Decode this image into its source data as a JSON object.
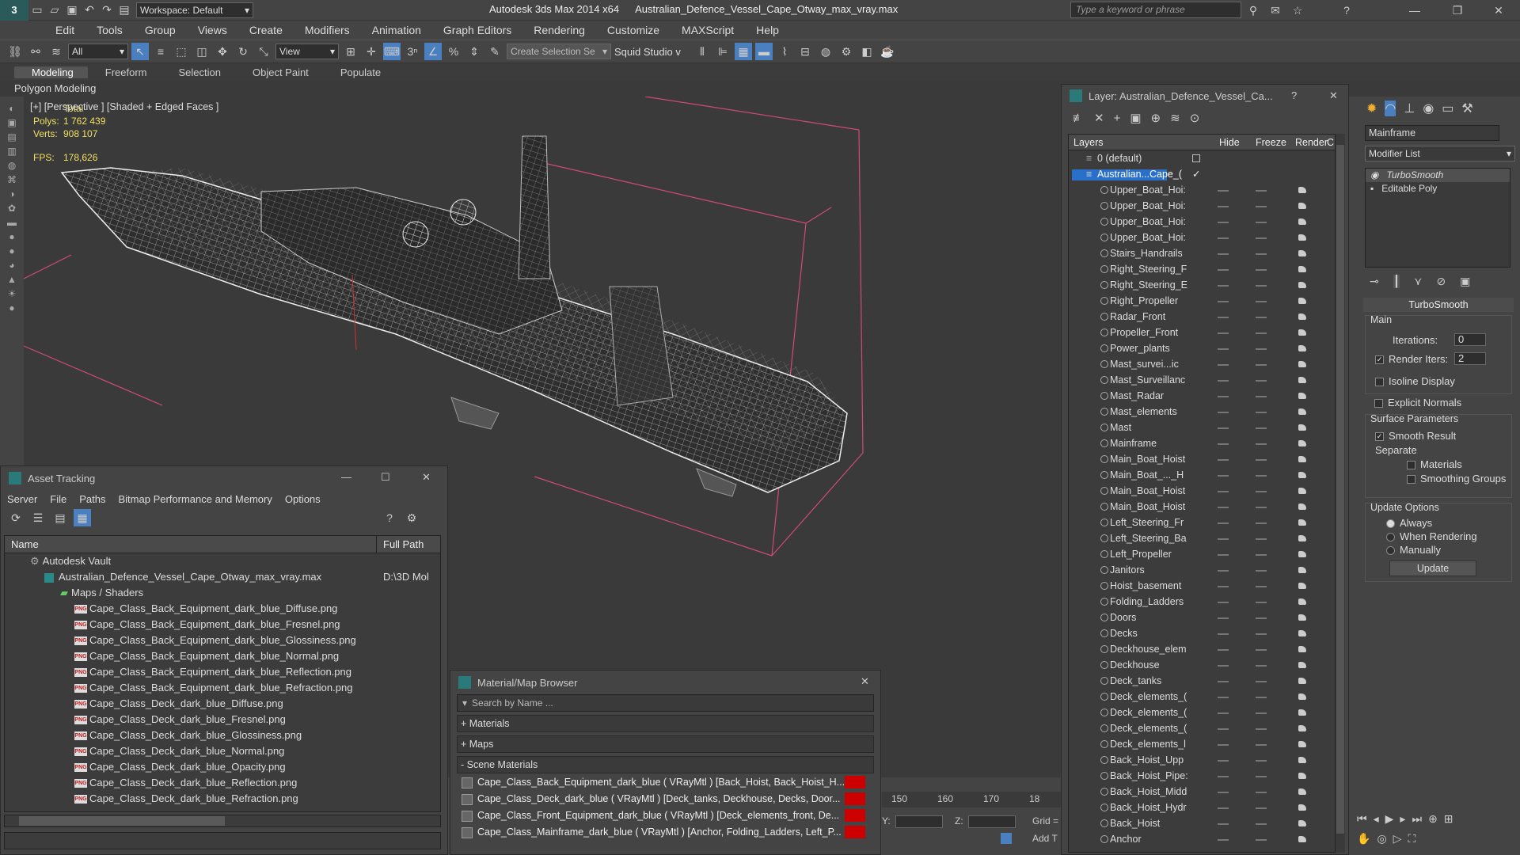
{
  "app": {
    "title": "Autodesk 3ds Max  2014 x64",
    "file": "Australian_Defence_Vessel_Cape_Otway_max_vray.max",
    "workspace": "Workspace: Default",
    "search_placeholder": "Type a keyword or phrase"
  },
  "menu": [
    "Edit",
    "Tools",
    "Group",
    "Views",
    "Create",
    "Modifiers",
    "Animation",
    "Graph Editors",
    "Rendering",
    "Customize",
    "MAXScript",
    "Help"
  ],
  "toolbar": {
    "filter": "All",
    "view": "View",
    "selection_set": "Create Selection Se",
    "squid": "Squid Studio v"
  },
  "ribbon": {
    "tabs": [
      "Modeling",
      "Freeform",
      "Selection",
      "Object Paint",
      "Populate"
    ],
    "sub": "Polygon Modeling"
  },
  "viewport": {
    "label": "[+] [Perspective ] [Shaded + Edged Faces ]",
    "stats_header": "Total",
    "polys_label": "Polys:",
    "polys": "1 762 439",
    "verts_label": "Verts:",
    "verts": "908 107",
    "fps_label": "FPS:",
    "fps": "178,626"
  },
  "asset_tracking": {
    "title": "Asset Tracking",
    "menu": [
      "Server",
      "File",
      "Paths",
      "Bitmap Performance and Memory",
      "Options"
    ],
    "col_name": "Name",
    "col_path": "Full Path",
    "vault": "Autodesk Vault",
    "file": "Australian_Defence_Vessel_Cape_Otway_max_vray.max",
    "file_path": "D:\\3D Mol",
    "maps_group": "Maps / Shaders",
    "maps": [
      "Cape_Class_Back_Equipment_dark_blue_Diffuse.png",
      "Cape_Class_Back_Equipment_dark_blue_Fresnel.png",
      "Cape_Class_Back_Equipment_dark_blue_Glossiness.png",
      "Cape_Class_Back_Equipment_dark_blue_Normal.png",
      "Cape_Class_Back_Equipment_dark_blue_Reflection.png",
      "Cape_Class_Back_Equipment_dark_blue_Refraction.png",
      "Cape_Class_Deck_dark_blue_Diffuse.png",
      "Cape_Class_Deck_dark_blue_Fresnel.png",
      "Cape_Class_Deck_dark_blue_Glossiness.png",
      "Cape_Class_Deck_dark_blue_Normal.png",
      "Cape_Class_Deck_dark_blue_Opacity.png",
      "Cape_Class_Deck_dark_blue_Reflection.png",
      "Cape_Class_Deck_dark_blue_Refraction.png"
    ]
  },
  "material_browser": {
    "title": "Material/Map Browser",
    "search_placeholder": "Search by Name ...",
    "sections": [
      "+ Materials",
      "+ Maps",
      "- Scene Materials"
    ],
    "scene_materials": [
      "Cape_Class_Back_Equipment_dark_blue  ( VRayMtl )  [Back_Hoist, Back_Hoist_H...",
      "Cape_Class_Deck_dark_blue  ( VRayMtl )  [Deck_tanks, Deckhouse, Decks, Door...",
      "Cape_Class_Front_Equipment_dark_blue  ( VRayMtl )  [Deck_elements_front, De...",
      "Cape_Class_Mainframe_dark_blue  ( VRayMtl )  [Anchor, Folding_Ladders, Left_P..."
    ]
  },
  "layer_manager": {
    "title": "Layer: Australian_Defence_Vessel_Ca...",
    "help": "?",
    "cols": [
      "Layers",
      "Hide",
      "Freeze",
      "Render",
      "C"
    ],
    "default_layer": "0 (default)",
    "active_layer": "Australian...Cape_(",
    "layers": [
      "Upper_Boat_Hoi:",
      "Upper_Boat_Hoi:",
      "Upper_Boat_Hoi:",
      "Upper_Boat_Hoi:",
      "Stairs_Handrails",
      "Right_Steering_F",
      "Right_Steering_E",
      "Right_Propeller",
      "Radar_Front",
      "Propeller_Front",
      "Power_plants",
      "Mast_survei...ic",
      "Mast_Surveillanc",
      "Mast_Radar",
      "Mast_elements",
      "Mast",
      "Mainframe",
      "Main_Boat_Hoist",
      "Main_Boat_..._H",
      "Main_Boat_Hoist",
      "Main_Boat_Hoist",
      "Left_Steering_Fr",
      "Left_Steering_Ba",
      "Left_Propeller",
      "Janitors",
      "Hoist_basement",
      "Folding_Ladders",
      "Doors",
      "Decks",
      "Deckhouse_elem",
      "Deckhouse",
      "Deck_tanks",
      "Deck_elements_(",
      "Deck_elements_(",
      "Deck_elements_(",
      "Deck_elements_l",
      "Back_Hoist_Upp",
      "Back_Hoist_Pipe:",
      "Back_Hoist_Midd",
      "Back_Hoist_Hydr",
      "Back_Hoist",
      "Anchor"
    ]
  },
  "command_panel": {
    "object_name": "Mainframe",
    "modifier_list": "Modifier List",
    "stack": [
      "TurboSmooth",
      "Editable Poly"
    ],
    "rollout": "TurboSmooth",
    "main": "Main",
    "iterations_label": "Iterations:",
    "iterations": "0",
    "render_iters_label": "Render Iters:",
    "render_iters": "2",
    "isoline": "Isoline Display",
    "explicit": "Explicit Normals",
    "surface": "Surface Parameters",
    "smooth": "Smooth Result",
    "separate": "Separate",
    "materials": "Materials",
    "smoothing": "Smoothing Groups",
    "update_opts": "Update Options",
    "always": "Always",
    "when_rendering": "When Rendering",
    "manually": "Manually",
    "update": "Update"
  },
  "timeline": {
    "ticks": [
      "150",
      "160",
      "170",
      "18"
    ],
    "y_label": "Y:",
    "z_label": "Z:",
    "grid_label": "Grid =",
    "add_t": "Add T"
  }
}
